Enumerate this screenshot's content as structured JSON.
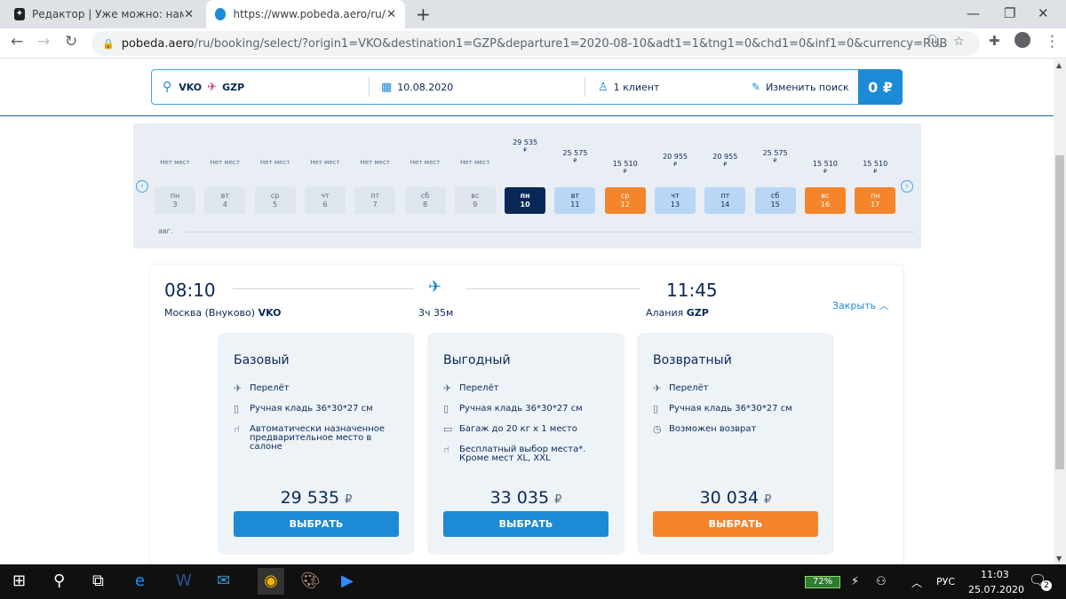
{
  "browser": {
    "tab1_title": "Редактор | Уже можно: нам раз",
    "tab2_title": "https://www.pobeda.aero/ru/boo",
    "url_domain": "pobeda.aero",
    "url_rest": "/ru/booking/select/?origin1=VKO&destination1=GZP&departure1=2020-08-10&adt1=1&tng1=0&chd1=0&inf1=0&currency=RUB"
  },
  "search": {
    "from": "VKO",
    "to": "GZP",
    "date": "10.08.2020",
    "pax": "1 клиент",
    "change": "Изменить поиск",
    "price": "0 ₽"
  },
  "calendar": {
    "month": "авг.",
    "days": [
      {
        "dow": "пн",
        "num": "3",
        "status": "Нет мест",
        "price": "",
        "kind": "empty"
      },
      {
        "dow": "вт",
        "num": "4",
        "status": "Нет мест",
        "price": "",
        "kind": "empty"
      },
      {
        "dow": "ср",
        "num": "5",
        "status": "Нет мест",
        "price": "",
        "kind": "empty"
      },
      {
        "dow": "чт",
        "num": "6",
        "status": "Нет мест",
        "price": "",
        "kind": "empty"
      },
      {
        "dow": "пт",
        "num": "7",
        "status": "Нет мест",
        "price": "",
        "kind": "empty"
      },
      {
        "dow": "сб",
        "num": "8",
        "status": "Нет мест",
        "price": "",
        "kind": "empty"
      },
      {
        "dow": "вс",
        "num": "9",
        "status": "Нет мест",
        "price": "",
        "kind": "empty"
      },
      {
        "dow": "пн",
        "num": "10",
        "status": "",
        "price": "29 535",
        "kind": "sel"
      },
      {
        "dow": "вт",
        "num": "11",
        "status": "",
        "price": "25 575",
        "kind": "blue"
      },
      {
        "dow": "ср",
        "num": "12",
        "status": "",
        "price": "15 510",
        "kind": "orange"
      },
      {
        "dow": "чт",
        "num": "13",
        "status": "",
        "price": "20 955",
        "kind": "blue"
      },
      {
        "dow": "пт",
        "num": "14",
        "status": "",
        "price": "20 955",
        "kind": "blue"
      },
      {
        "dow": "сб",
        "num": "15",
        "status": "",
        "price": "25 575",
        "kind": "blue"
      },
      {
        "dow": "вс",
        "num": "16",
        "status": "",
        "price": "15 510",
        "kind": "orange"
      },
      {
        "dow": "пн",
        "num": "17",
        "status": "",
        "price": "15 510",
        "kind": "orange"
      }
    ],
    "currency": "₽"
  },
  "flight": {
    "dep_time": "08:10",
    "arr_time": "11:45",
    "dep_city": "Москва (Внуково)",
    "dep_code": "VKO",
    "arr_city": "Алания",
    "arr_code": "GZP",
    "duration": "3ч 35м",
    "close": "Закрыть"
  },
  "tariffs": [
    {
      "name": "Базовый",
      "price": "29 535",
      "button": "ВЫБРАТЬ",
      "color": "#1d8ad6",
      "features": [
        {
          "icon": "plane-icon",
          "text": "Перелёт"
        },
        {
          "icon": "bag-icon",
          "text": "Ручная кладь 36*30*27 см"
        },
        {
          "icon": "seat-icon",
          "text": "Автоматически назначенное предварительное место в салоне"
        }
      ]
    },
    {
      "name": "Выгодный",
      "price": "33 035",
      "button": "ВЫБРАТЬ",
      "color": "#1d8ad6",
      "features": [
        {
          "icon": "plane-icon",
          "text": "Перелёт"
        },
        {
          "icon": "bag-icon",
          "text": "Ручная кладь 36*30*27 см"
        },
        {
          "icon": "luggage-icon",
          "text": "Багаж до 20 кг х 1 место"
        },
        {
          "icon": "seat-icon",
          "text": "Бесплатный выбор места*. Кроме мест XL, XXL"
        }
      ]
    },
    {
      "name": "Возвратный",
      "price": "30 034",
      "button": "ВЫБРАТЬ",
      "color": "#f4852a",
      "features": [
        {
          "icon": "plane-icon",
          "text": "Перелёт"
        },
        {
          "icon": "bag-icon",
          "text": "Ручная кладь 36*30*27 см"
        },
        {
          "icon": "clock-icon",
          "text": "Возможен возврат"
        }
      ]
    }
  ],
  "taskbar": {
    "battery": "72%",
    "lang": "РУС",
    "time": "11:03",
    "date": "25.07.2020",
    "notif": "2"
  }
}
